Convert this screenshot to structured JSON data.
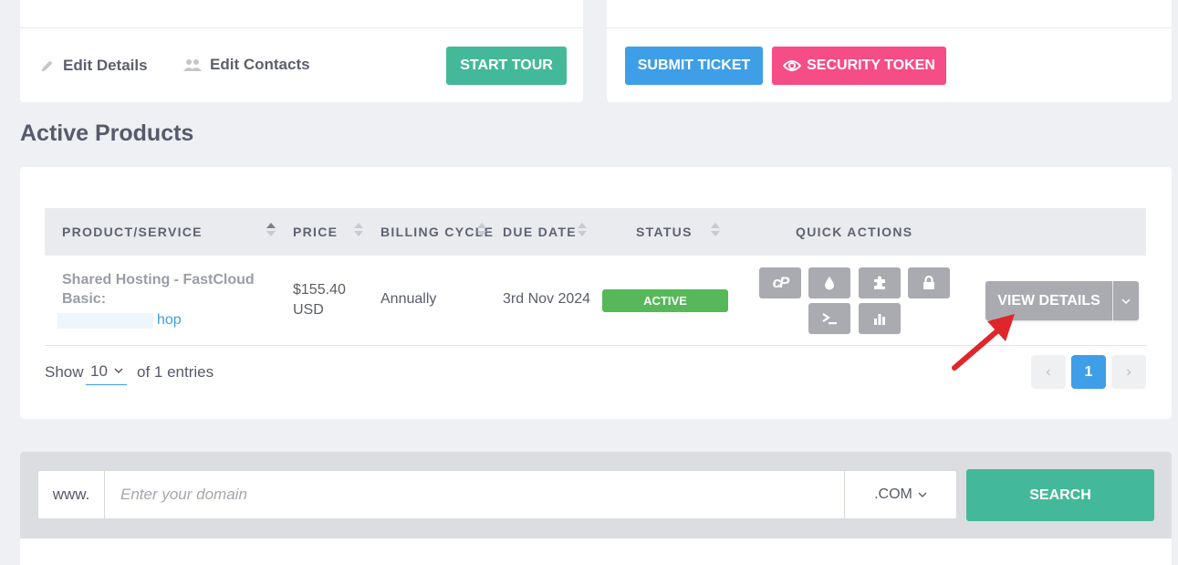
{
  "profile_card": {
    "edit_details": "Edit Details",
    "edit_contacts": "Edit Contacts",
    "start_tour": "START TOUR"
  },
  "support_card": {
    "submit_ticket": "SUBMIT TICKET",
    "security_token": "SECURITY TOKEN"
  },
  "section_title": "Active Products",
  "table": {
    "columns": [
      "PRODUCT/SERVICE",
      "PRICE",
      "BILLING CYCLE",
      "DUE DATE",
      "STATUS",
      "QUICK ACTIONS"
    ],
    "rows": [
      {
        "product_name": "Shared Hosting - FastCloud Basic:",
        "domain_suffix": "hop",
        "price_amount": "$155.40",
        "price_currency": "USD",
        "billing_cycle": "Annually",
        "due_date": "3rd Nov 2024",
        "status": "ACTIVE",
        "quick_actions": [
          "cpanel-icon",
          "drop-icon",
          "puzzle-icon",
          "lock-icon",
          "terminal-icon",
          "bar-chart-icon"
        ],
        "view_details": "VIEW DETAILS"
      }
    ],
    "show_label": "Show",
    "page_size": "10",
    "entries_label": "of 1 entries",
    "current_page": "1"
  },
  "domain_search": {
    "prefix": "www.",
    "placeholder": "Enter your domain",
    "tld": ".COM",
    "button": "SEARCH"
  },
  "colors": {
    "green": "#44b999",
    "blue": "#3e9ee8",
    "pink": "#f64d87",
    "active": "#57b85a",
    "annotation_arrow": "#e0262a"
  }
}
